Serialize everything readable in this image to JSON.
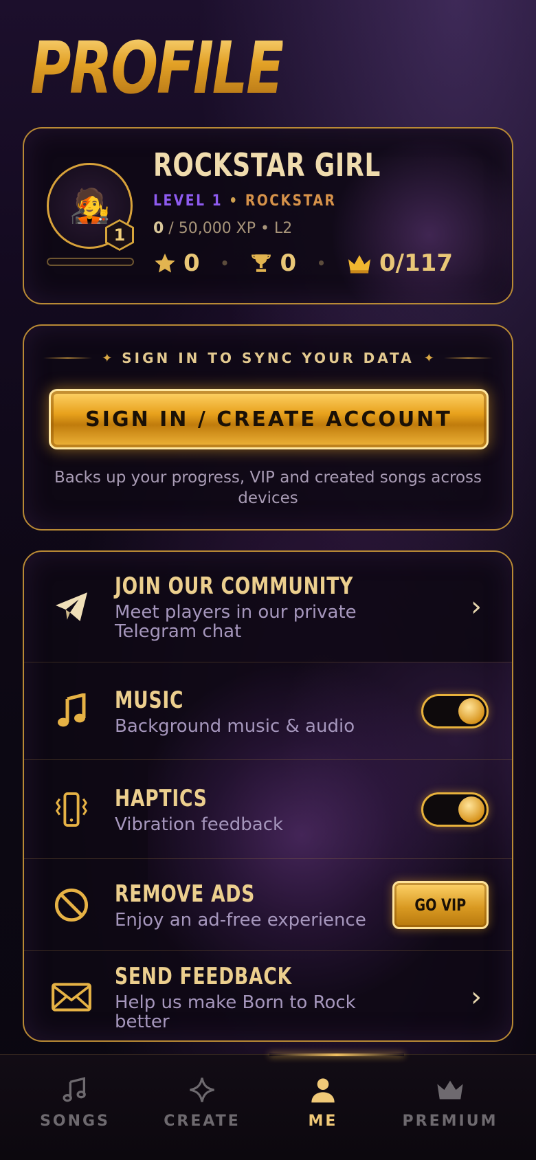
{
  "header": {
    "title": "PROFILE"
  },
  "profile": {
    "avatar_emoji": "🧑‍🎤",
    "level_badge": "1",
    "name": "ROCKSTAR GIRL",
    "level_label": "LEVEL 1",
    "separator": "•",
    "rank": "ROCKSTAR",
    "xp_current": "0",
    "xp_rest": " / 50,000 XP • L2",
    "xp_progress": 0,
    "stars": "0",
    "trophies": "0",
    "crowns": "0/117"
  },
  "signin": {
    "heading": "SIGN IN TO SYNC YOUR DATA",
    "deco_star": "✦",
    "button_label": "SIGN IN / CREATE ACCOUNT",
    "note": "Backs up your progress, VIP and created songs across devices"
  },
  "settings": {
    "community": {
      "title": "JOIN OUR COMMUNITY",
      "subtitle": "Meet players in our private Telegram chat",
      "chevron": "›"
    },
    "music": {
      "title": "MUSIC",
      "subtitle": "Background music & audio",
      "enabled": true
    },
    "haptics": {
      "title": "HAPTICS",
      "subtitle": "Vibration feedback",
      "enabled": true
    },
    "ads": {
      "title": "REMOVE ADS",
      "subtitle": "Enjoy an ad-free experience",
      "button": "GO VIP"
    },
    "feedback": {
      "title": "SEND FEEDBACK",
      "subtitle": "Help us make Born to Rock better",
      "chevron": "›"
    }
  },
  "nav": {
    "tabs": [
      {
        "label": "SONGS",
        "icon": "music-note-icon"
      },
      {
        "label": "CREATE",
        "icon": "sparkle-icon"
      },
      {
        "label": "ME",
        "icon": "person-icon",
        "active": true
      },
      {
        "label": "PREMIUM",
        "icon": "crown-icon"
      }
    ]
  },
  "colors": {
    "gold": "#e8b23c",
    "purple": "#8e5bf0",
    "bg": "#0d0814"
  }
}
